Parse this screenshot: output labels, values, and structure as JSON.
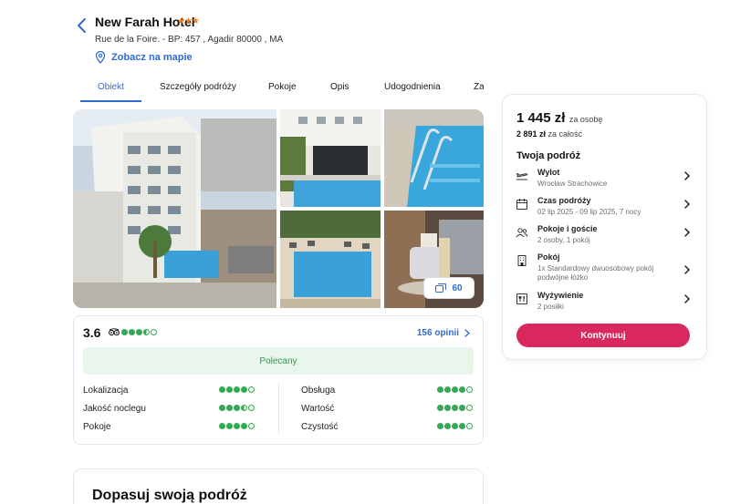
{
  "header": {
    "hotel_name": "New Farah Hotel",
    "stars": "★★★",
    "address": "Rue de la Foire. - BP: 457 , Agadir 80000 , MA",
    "map_link": "Zobacz na mapie"
  },
  "tabs": [
    {
      "label": "Obiekt",
      "active": true
    },
    {
      "label": "Szczegóły podróży"
    },
    {
      "label": "Pokoje"
    },
    {
      "label": "Opis"
    },
    {
      "label": "Udogodnienia"
    },
    {
      "label": "Za"
    }
  ],
  "gallery": {
    "photo_count": "60"
  },
  "reviews": {
    "score": "3.6",
    "tripadvisor_rating": 3.5,
    "link": "156 opinii",
    "badge": "Polecany",
    "categories": [
      {
        "label": "Lokalizacja",
        "rating": 4
      },
      {
        "label": "Jakość noclegu",
        "rating": 3.5
      },
      {
        "label": "Pokoje",
        "rating": 4
      },
      {
        "label": "Obsługa",
        "rating": 4
      },
      {
        "label": "Wartość",
        "rating": 4
      },
      {
        "label": "Czystość",
        "rating": 4
      }
    ]
  },
  "customize": {
    "title": "Dopasuj swoją podróż"
  },
  "booking": {
    "price": "1 445 zł",
    "price_per": "za osobę",
    "total_amount": "2 891 zł",
    "total_label": "za całość",
    "section_title": "Twoja podróż",
    "rows": [
      {
        "icon": "plane-icon",
        "title": "Wylot",
        "sub": "Wrocław Strachowice"
      },
      {
        "icon": "calendar-icon",
        "title": "Czas podróży",
        "sub": "02 lip 2025 - 09 lip 2025, 7 nocy"
      },
      {
        "icon": "people-icon",
        "title": "Pokoje i goście",
        "sub": "2 osoby, 1 pokój"
      },
      {
        "icon": "building-icon",
        "title": "Pokój",
        "sub": "1x Standardowy dwuosobowy pokój podwójne łóżko"
      },
      {
        "icon": "meal-icon",
        "title": "Wyżywienie",
        "sub": "2 posiłki"
      }
    ],
    "button": "Kontynuuj"
  },
  "colors": {
    "accent_blue": "#2f6bd0",
    "star_orange": "#f07d1c",
    "rating_green": "#34a853",
    "button_pink": "#d8285e"
  }
}
